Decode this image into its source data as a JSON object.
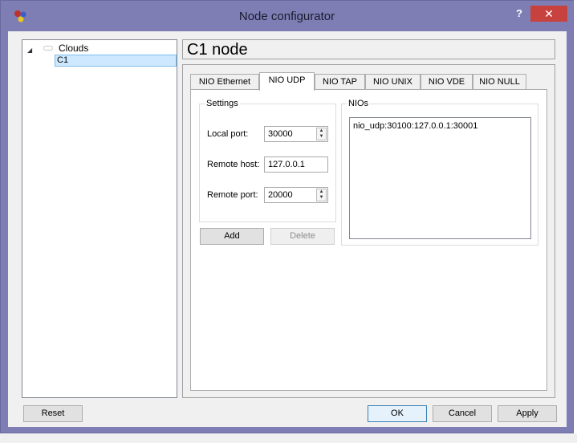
{
  "window": {
    "title": "Node configurator",
    "help_glyph": "?",
    "close_glyph": "✕"
  },
  "tree": {
    "root_label": "Clouds",
    "child_label": "C1"
  },
  "node_title": "C1 node",
  "tabs": [
    {
      "label": "NIO Ethernet"
    },
    {
      "label": "NIO UDP"
    },
    {
      "label": "NIO TAP"
    },
    {
      "label": "NIO UNIX"
    },
    {
      "label": "NIO VDE"
    },
    {
      "label": "NIO NULL"
    }
  ],
  "settings": {
    "group_title": "Settings",
    "local_port_label": "Local port:",
    "local_port_value": "30000",
    "remote_host_label": "Remote host:",
    "remote_host_value": "127.0.0.1",
    "remote_port_label": "Remote port:",
    "remote_port_value": "20000"
  },
  "nios": {
    "group_title": "NIOs",
    "items": [
      "nio_udp:30100:127.0.0.1:30001"
    ]
  },
  "buttons": {
    "add": "Add",
    "delete": "Delete",
    "reset": "Reset",
    "ok": "OK",
    "cancel": "Cancel",
    "apply": "Apply"
  },
  "colors": {
    "title_bar": "#7f7eb4",
    "close_button": "#c7423e",
    "selection": "#cde8ff"
  }
}
